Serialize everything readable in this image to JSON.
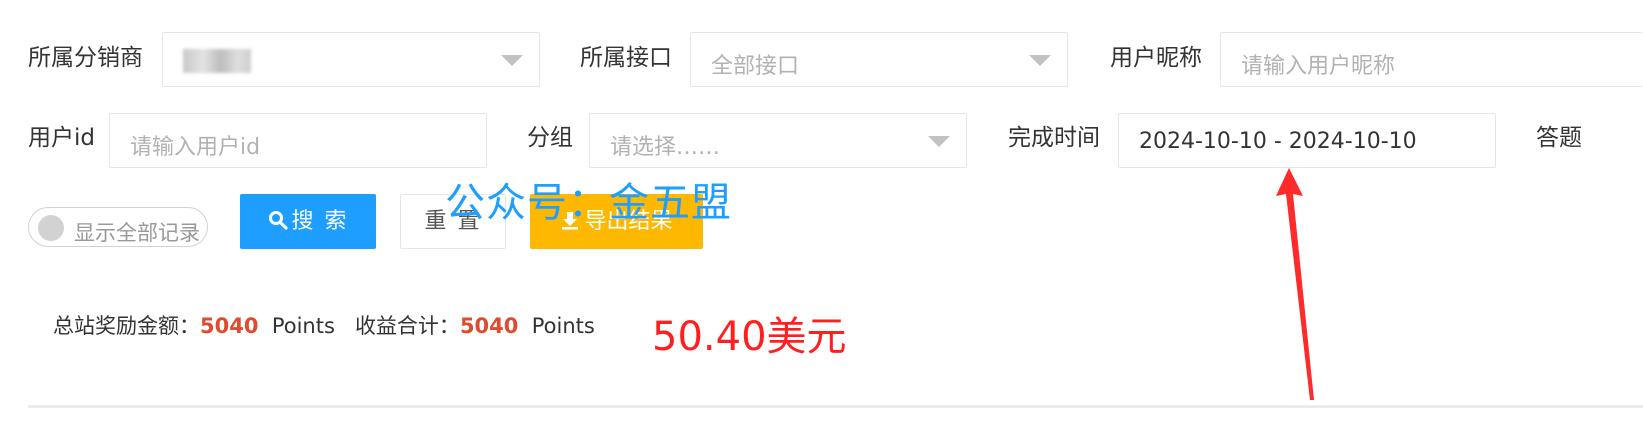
{
  "filters": {
    "distributor": {
      "label": "所属分销商",
      "value_suffix": ""
    },
    "interface": {
      "label": "所属接口",
      "placeholder": "全部接口"
    },
    "nickname": {
      "label": "用户昵称",
      "placeholder": "请输入用户昵称"
    },
    "user_id": {
      "label": "用户id",
      "placeholder": "请输入用户id"
    },
    "group": {
      "label": "分组",
      "placeholder": "请选择……"
    },
    "complete_time": {
      "label": "完成时间",
      "value": "2024-10-10 - 2024-10-10"
    },
    "answer_cut": {
      "label": "答题"
    }
  },
  "toggle": {
    "label": "显示全部记录",
    "on": false
  },
  "buttons": {
    "search": "搜 索",
    "reset": "重 置",
    "export": "导出结果"
  },
  "watermark": "公众号：金五盟",
  "stats": {
    "reward_label": "总站奖励金额：",
    "reward_value": "5040",
    "reward_unit": "Points",
    "income_label": "收益合计：",
    "income_value": "5040",
    "income_unit": "Points",
    "usd": "50.40美元"
  },
  "colors": {
    "primary": "#1e9fff",
    "warm": "#ffb800",
    "number": "#e04b2f",
    "usd": "#ff1f1f",
    "arrow": "#ff2a2a"
  },
  "icons": [
    "search-icon",
    "download-icon",
    "chevron-down-icon",
    "arrow-annotation"
  ]
}
